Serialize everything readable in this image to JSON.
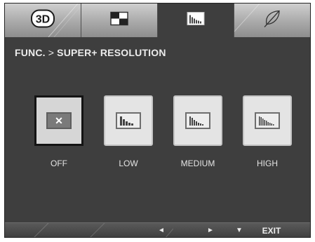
{
  "tabs": [
    {
      "name": "3d-icon",
      "label": "3D",
      "active": false
    },
    {
      "name": "picture-icon",
      "active": false
    },
    {
      "name": "function-icon",
      "active": true
    },
    {
      "name": "leaf-icon",
      "active": false
    }
  ],
  "breadcrumb": {
    "parent": "FUNC.",
    "separator": ">",
    "current": "SUPER+ RESOLUTION"
  },
  "options": [
    {
      "label": "OFF",
      "icon": "x",
      "selected": true
    },
    {
      "label": "LOW",
      "icon": "low-bars",
      "selected": false
    },
    {
      "label": "MEDIUM",
      "icon": "medium-bars",
      "selected": false
    },
    {
      "label": "HIGH",
      "icon": "high-bars",
      "selected": false
    }
  ],
  "nav": {
    "left": "◄",
    "right": "►",
    "down": "▼",
    "exit": "EXIT"
  },
  "colors": {
    "panel": "#3e3e3e",
    "tab_inactive": "#a9a9a9",
    "button": "#e4e4e4",
    "selected_border": "#141414"
  }
}
